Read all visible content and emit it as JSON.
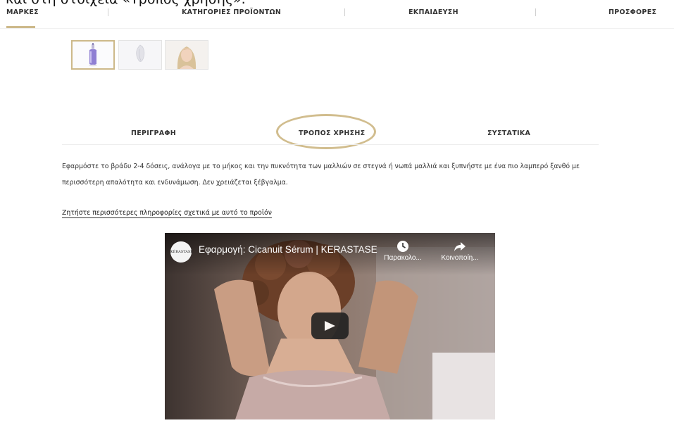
{
  "caption": {
    "text": "και στη στοιχεία «Τρόπος χρήσης»."
  },
  "nav": {
    "items": [
      {
        "label": "ΜΑΡΚΕΣ",
        "active": true
      },
      {
        "label": "ΚΑΤΗΓΟΡΙΕΣ ΠΡΟΪΟΝΤΩΝ"
      },
      {
        "label": "ΕΚΠΑΙΔΕΥΣΗ"
      },
      {
        "label": "ΠΡΟΣΦΟΡΕΣ"
      }
    ],
    "accent_color": "#cdb98a"
  },
  "thumbnails": [
    {
      "icon": "serum-bottle-icon",
      "active": true
    },
    {
      "icon": "hair-strand-icon"
    },
    {
      "icon": "model-portrait-icon"
    }
  ],
  "tabs": [
    {
      "label": "ΠΕΡΙΓΡΑΦΗ"
    },
    {
      "label": "ΤΡΟΠΟΣ ΧΡΗΣΗΣ",
      "highlighted": true
    },
    {
      "label": "ΣΥΣΤΑΤΙΚΑ"
    }
  ],
  "usage": {
    "text": "Εφαρμόστε το βράδυ 2-4 δόσεις, ανάλογα με το μήκος και την πυκνότητα των μαλλιών σε στεγνά ή νωπά μαλλιά και ξυπνήστε με ένα πιο λαμπερό ξανθό με περισσότερη απαλότητα και ενδυνάμωση. Δεν χρειάζεται ξέβγαλμα."
  },
  "info_link": {
    "text": "Ζητήστε περισσότερες πληροφορίες σχετικά με αυτό το προϊόν"
  },
  "video": {
    "channel_logo_text": "KÉRASTASE",
    "title": "Εφαρμογή: Cicanuit Sérum | KERASTASE",
    "watch_later_label": "Παρακολο...",
    "share_label": "Κοινοποίη..."
  }
}
